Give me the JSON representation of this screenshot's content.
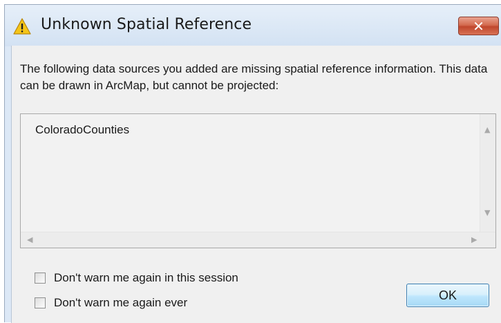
{
  "window": {
    "title": "Unknown Spatial Reference",
    "close_label": "✕",
    "icon": "warning-icon"
  },
  "message": "The following data sources you added are missing spatial reference information. This data can be drawn in ArcMap, but cannot be projected:",
  "data_sources": [
    "ColoradoCounties"
  ],
  "checkboxes": {
    "session": {
      "label": "Don't warn me again in this session",
      "checked": false
    },
    "ever": {
      "label": "Don't warn me again ever",
      "checked": false
    }
  },
  "ok_label": "OK",
  "colors": {
    "close_button": "#c94f35",
    "ok_button_border": "#3c7fb1",
    "title_bar": "#dce8f6",
    "warning_yellow": "#f5c518"
  }
}
